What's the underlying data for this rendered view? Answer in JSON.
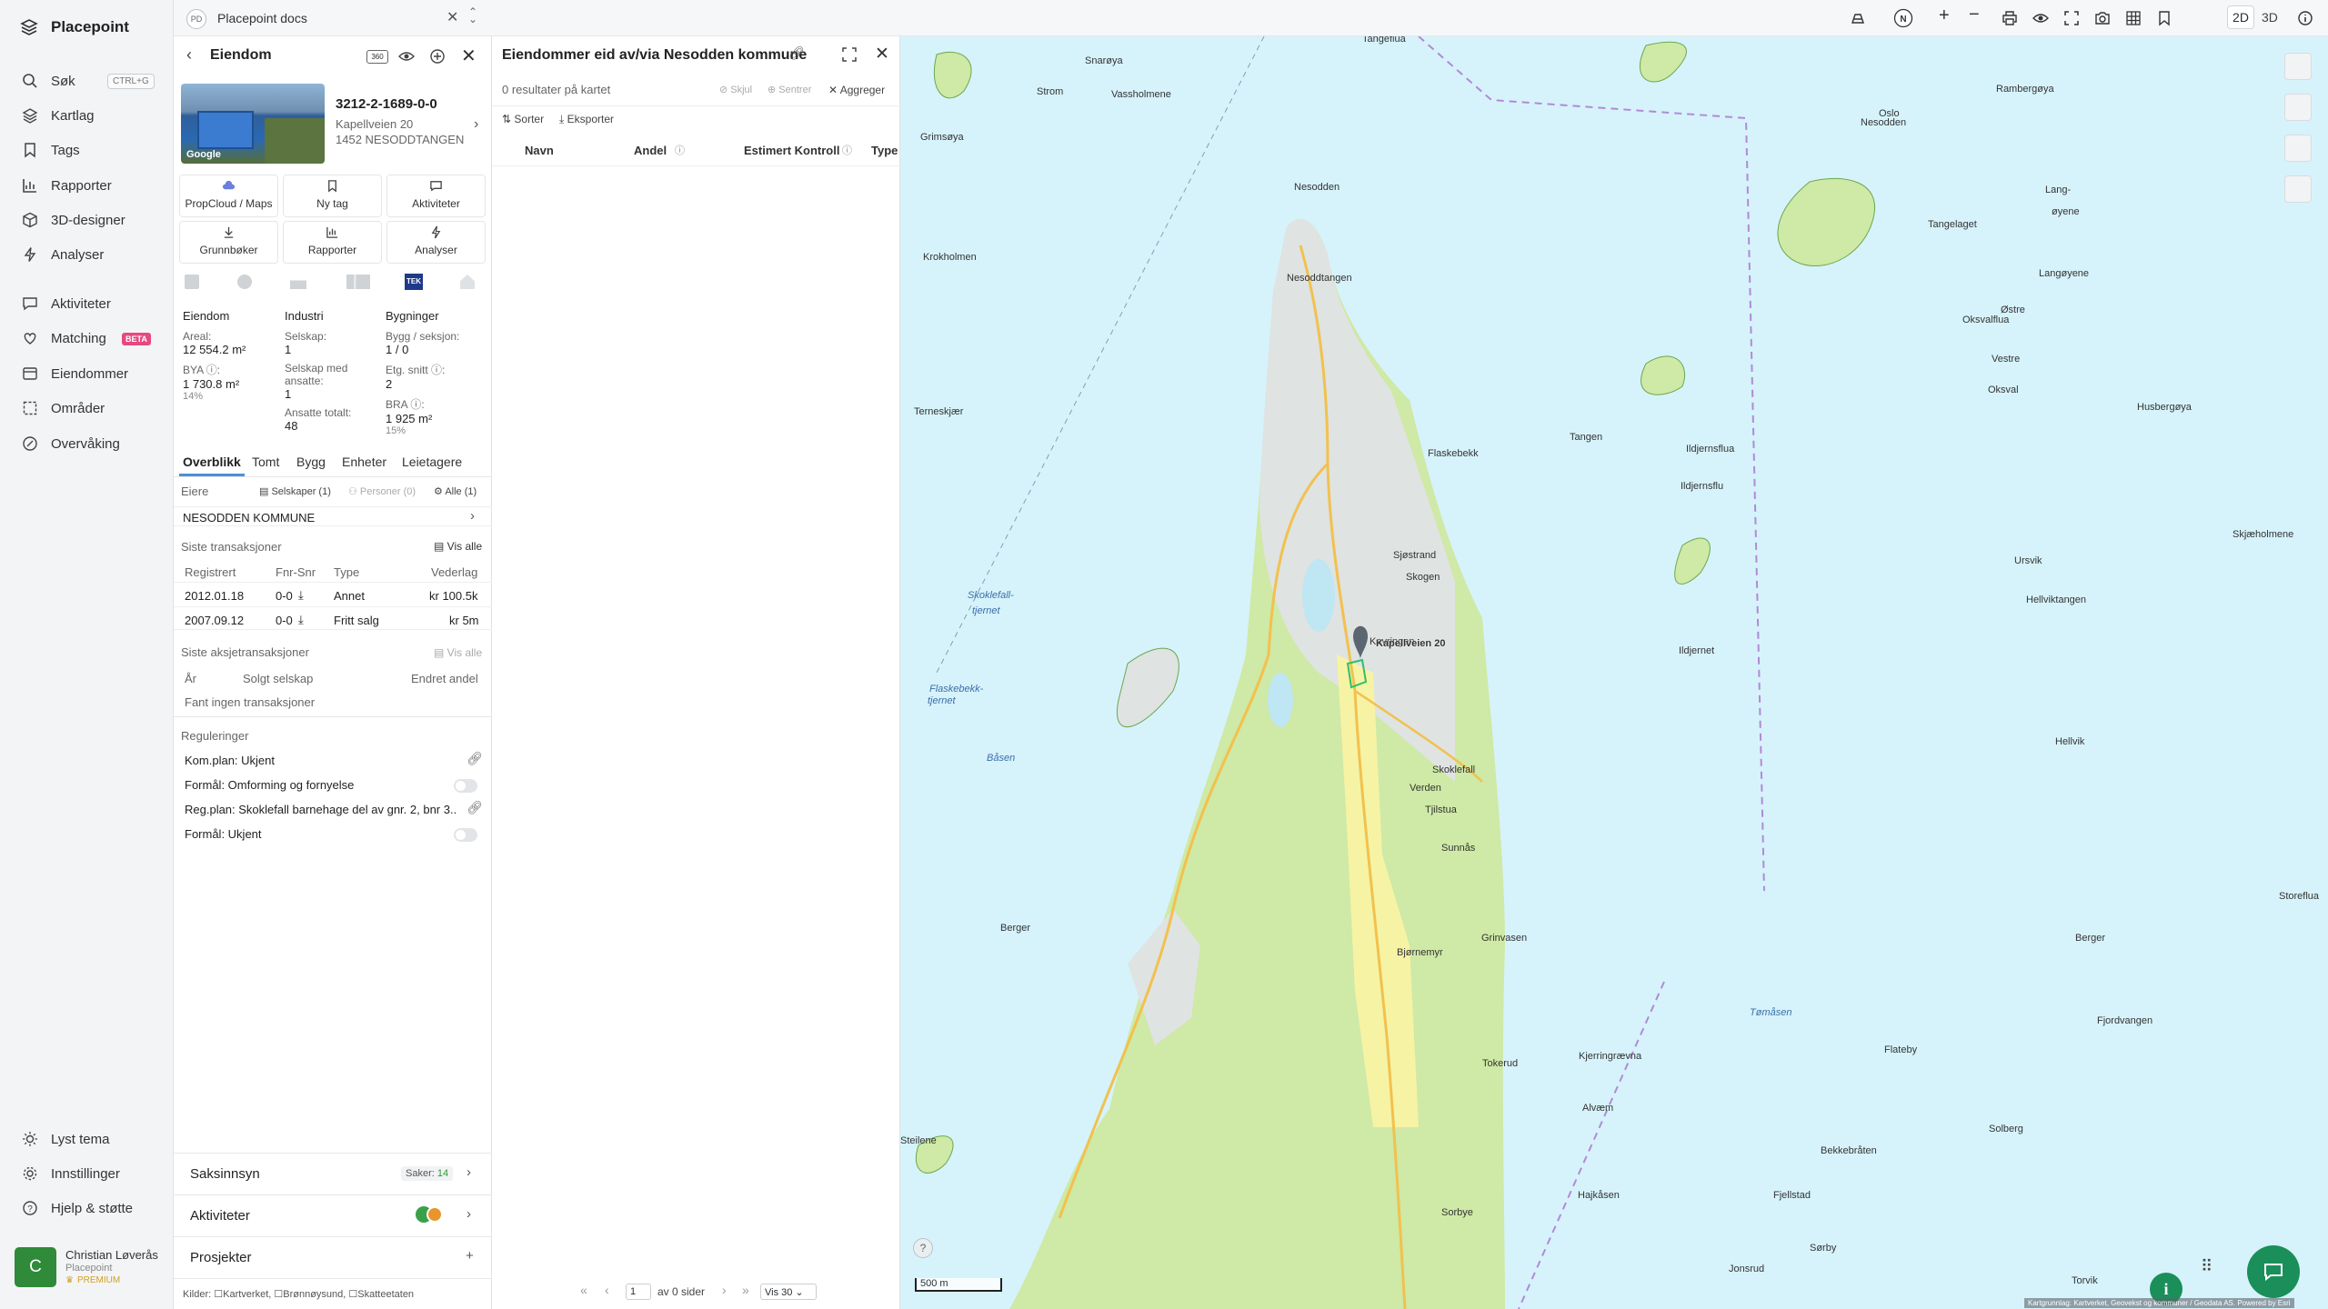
{
  "sidebar": {
    "brand": "Placepoint",
    "items": [
      {
        "label": "Søk",
        "icon": "search-icon"
      },
      {
        "label": "Kartlag",
        "icon": "layers-icon"
      },
      {
        "label": "Tags",
        "icon": "bookmark-icon"
      },
      {
        "label": "Rapporter",
        "icon": "chart-icon"
      },
      {
        "label": "3D-designer",
        "icon": "cube-icon"
      },
      {
        "label": "Analyser",
        "icon": "bolt-icon"
      },
      {
        "label": "Aktiviteter",
        "icon": "chat-icon"
      },
      {
        "label": "Matching",
        "icon": "match-icon"
      },
      {
        "label": "Eiendommer",
        "icon": "building-icon"
      },
      {
        "label": "Områder",
        "icon": "area-icon"
      },
      {
        "label": "Overvåking",
        "icon": "monitor-icon"
      }
    ],
    "search_shortcut": "CTRL+G",
    "beta_badge": "BETA",
    "bottom": [
      {
        "label": "Lyst tema",
        "icon": "sun-icon"
      },
      {
        "label": "Innstillinger",
        "icon": "gear-icon"
      },
      {
        "label": "Hjelp & støtte",
        "icon": "help-icon"
      }
    ],
    "user": {
      "initial": "C",
      "name": "Christian Løverås",
      "org": "Placepoint",
      "plan": "PREMIUM"
    }
  },
  "doc_tab": {
    "badge": "PD",
    "title": "Placepoint docs"
  },
  "property": {
    "panel_title": "Eiendom",
    "id": "3212-2-1689-0-0",
    "address": "Kapellveien 20",
    "postal": "1452 NESODDTANGEN",
    "photo_credit": "Google",
    "actions": [
      "PropCloud / Maps",
      "Ny tag",
      "Aktiviteter",
      "Grunnbøker",
      "Rapporter",
      "Analyser"
    ],
    "source_badge": "TEK",
    "cols": [
      {
        "head": "Eiendom",
        "items": [
          {
            "k": "Areal:",
            "v": "12 554.2 m²"
          },
          {
            "k": "BYA ⓘ:",
            "v": "1 730.8 m²",
            "s": "14%"
          }
        ]
      },
      {
        "head": "Industri",
        "items": [
          {
            "k": "Selskap:",
            "v": "1"
          },
          {
            "k": "Selskap med ansatte:",
            "v": "1"
          },
          {
            "k": "Ansatte totalt:",
            "v": "48"
          }
        ]
      },
      {
        "head": "Bygninger",
        "items": [
          {
            "k": "Bygg / seksjon:",
            "v": "1 / 0"
          },
          {
            "k": "Etg. snitt ⓘ:",
            "v": "2"
          },
          {
            "k": "BRA ⓘ:",
            "v": "1 925 m²",
            "s": "15%"
          }
        ]
      }
    ],
    "tabs": [
      "Overblikk",
      "Tomt",
      "Bygg",
      "Enheter",
      "Leietagere"
    ],
    "owners": {
      "label": "Eiere",
      "filters": [
        "Selskaper (1)",
        "Personer (0)",
        "Alle (1)"
      ],
      "owner": "NESODDEN KOMMUNE"
    },
    "transactions": {
      "title": "Siste transaksjoner",
      "show_all": "Vis alle",
      "headers": [
        "Registrert",
        "Fnr-Snr",
        "Type",
        "Vederlag"
      ],
      "rows": [
        {
          "date": "2012.01.18",
          "fnr": "0-0",
          "type": "Annet",
          "value": "kr 100.5k"
        },
        {
          "date": "2007.09.12",
          "fnr": "0-0",
          "type": "Fritt salg",
          "value": "kr 5m"
        }
      ]
    },
    "share_tx": {
      "title": "Siste aksjetransaksjoner",
      "show_all": "Vis alle",
      "headers": [
        "År",
        "Solgt selskap",
        "Endret andel"
      ],
      "empty": "Fant ingen transaksjoner"
    },
    "regulations": {
      "title": "Reguleringer",
      "rows": [
        "Kom.plan: Ukjent",
        "Formål: Omforming og fornyelse",
        "Reg.plan: Skoklefall barnehage del av gnr. 2, bnr 3...",
        "Formål: Ukjent"
      ]
    },
    "accordions": [
      {
        "label": "Saksinnsyn",
        "extra": "Saker:",
        "count": "14"
      },
      {
        "label": "Aktiviteter"
      },
      {
        "label": "Prosjekter"
      }
    ],
    "sources": [
      "Kilder:",
      "Kartverket,",
      "Brønnøysund,",
      "Skatteetaten"
    ]
  },
  "results": {
    "title": "Eiendommer eid av/via Nesodden kommune",
    "count_text": "0 resultater på kartet",
    "actions": [
      "Skjul",
      "Sentrer",
      "Aggreger"
    ],
    "toolbar": [
      "Sorter",
      "Eksporter"
    ],
    "columns": [
      "Navn",
      "Andel",
      "Estimert Kontroll",
      "Type"
    ],
    "pager": {
      "page": "1",
      "of_text": "av 0 sider",
      "per_page": "Vis 30"
    }
  },
  "map": {
    "mode_2d": "2D",
    "mode_3d": "3D",
    "scale": "500 m",
    "attribution": "Kartgrunnlag: Kartverket, Geovekst og kommuner / Geodata AS. Powered by Esri",
    "marker_label": "Kapellveien 20",
    "place_labels": [
      {
        "t": "Tangeflua",
        "w": false
      },
      {
        "t": "Snarøya",
        "w": false
      },
      {
        "t": "Strom",
        "w": false
      },
      {
        "t": "Vassholmene",
        "w": false
      },
      {
        "t": "Grimsøya",
        "w": false
      },
      {
        "t": "Oslo",
        "w": false
      },
      {
        "t": "Nesodden",
        "w": false
      },
      {
        "t": "Rambergøya",
        "w": false
      },
      {
        "t": "Lang-",
        "w": false
      },
      {
        "t": "øyene",
        "w": false
      },
      {
        "t": "Langøyene",
        "w": false
      },
      {
        "t": "Tangelaget",
        "w": false
      },
      {
        "t": "Nesodden",
        "w": false
      },
      {
        "t": "Nesoddtangen",
        "w": false
      },
      {
        "t": "Oksvalflua",
        "w": false
      },
      {
        "t": "Østre",
        "w": false
      },
      {
        "t": "Vestre",
        "w": false
      },
      {
        "t": "Oksval",
        "w": false
      },
      {
        "t": "Krokholmen",
        "w": false
      },
      {
        "t": "Terneskjær",
        "w": false
      },
      {
        "t": "Flaskebekk",
        "w": false
      },
      {
        "t": "Tangen",
        "w": false
      },
      {
        "t": "Husbergøya",
        "w": false
      },
      {
        "t": "Ildjernsflua",
        "w": false
      },
      {
        "t": "Ildjernsflu",
        "w": false
      },
      {
        "t": "Skjæholmene",
        "w": false
      },
      {
        "t": "Sjøstrand",
        "w": false
      },
      {
        "t": "Skogen",
        "w": false
      },
      {
        "t": "Ursvik",
        "w": false
      },
      {
        "t": "Skoklefall-",
        "w": true
      },
      {
        "t": "tjernet",
        "w": true
      },
      {
        "t": "Hellviktangen",
        "w": false
      },
      {
        "t": "Kavringen",
        "w": false
      },
      {
        "t": "Ildjernet",
        "w": false
      },
      {
        "t": "Flaskebekk-",
        "w": true
      },
      {
        "t": "tjernet",
        "w": true
      },
      {
        "t": "Hellvik",
        "w": false
      },
      {
        "t": "Steilene",
        "w": false
      },
      {
        "t": "Båsen",
        "w": true
      },
      {
        "t": "Skoklefall",
        "w": false
      },
      {
        "t": "Verden",
        "w": false
      },
      {
        "t": "Tjilstua",
        "w": false
      },
      {
        "t": "Sunnås",
        "w": false
      },
      {
        "t": "Storeflua",
        "w": false
      },
      {
        "t": "Berger",
        "w": false
      },
      {
        "t": "Berger",
        "w": false
      },
      {
        "t": "Grinvasen",
        "w": false
      },
      {
        "t": "Bjørnemyr",
        "w": false
      },
      {
        "t": "Fjordvangen",
        "w": false
      },
      {
        "t": "Tømåsen",
        "w": true
      },
      {
        "t": "Flateby",
        "w": false
      },
      {
        "t": "Tokerud",
        "w": false
      },
      {
        "t": "Kjerringrævna",
        "w": false
      },
      {
        "t": "Alvæm",
        "w": false
      },
      {
        "t": "Solberg",
        "w": false
      },
      {
        "t": "Bekkebråten",
        "w": false
      },
      {
        "t": "Hajkåsen",
        "w": false
      },
      {
        "t": "Fjellstad",
        "w": false
      },
      {
        "t": "Torvik",
        "w": false
      },
      {
        "t": "Jonsrud",
        "w": false
      },
      {
        "t": "Sørby",
        "w": false
      },
      {
        "t": "Sorbye",
        "w": false
      }
    ]
  }
}
